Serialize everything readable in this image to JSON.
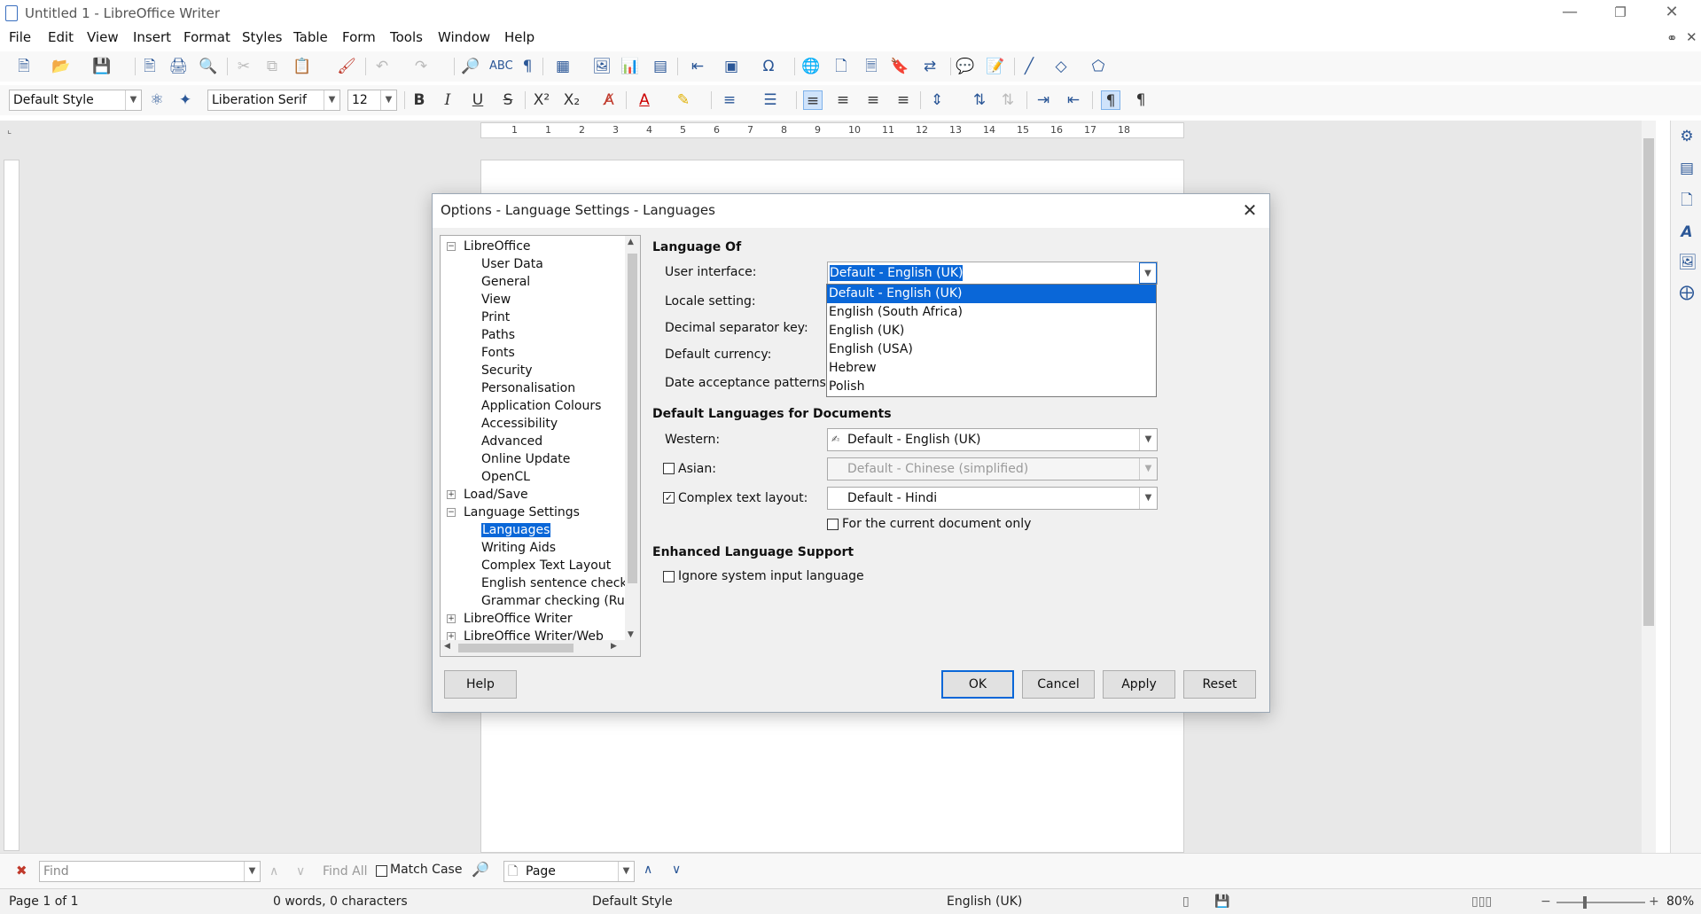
{
  "window": {
    "title": "Untitled 1 - LibreOffice Writer"
  },
  "menu": [
    "File",
    "Edit",
    "View",
    "Insert",
    "Format",
    "Styles",
    "Table",
    "Form",
    "Tools",
    "Window",
    "Help"
  ],
  "formatting": {
    "paragraph_style": "Default Style",
    "font_name": "Liberation Serif",
    "font_size": "12"
  },
  "ruler_ticks": [
    "1",
    "1",
    "2",
    "3",
    "4",
    "5",
    "6",
    "7",
    "8",
    "9",
    "10",
    "11",
    "12",
    "13",
    "14",
    "15",
    "16",
    "17",
    "18"
  ],
  "findbar": {
    "find_placeholder": "Find",
    "find_all": "Find All",
    "match_case": "Match Case",
    "nav_target": "Page"
  },
  "status": {
    "page": "Page 1 of 1",
    "words": "0 words, 0 characters",
    "style": "Default Style",
    "language": "English (UK)",
    "zoom": "80%"
  },
  "dialog": {
    "title": "Options - Language Settings - Languages",
    "tree": [
      {
        "label": "LibreOffice",
        "level": 0,
        "expander": "−"
      },
      {
        "label": "User Data",
        "level": 1
      },
      {
        "label": "General",
        "level": 1
      },
      {
        "label": "View",
        "level": 1
      },
      {
        "label": "Print",
        "level": 1
      },
      {
        "label": "Paths",
        "level": 1
      },
      {
        "label": "Fonts",
        "level": 1
      },
      {
        "label": "Security",
        "level": 1
      },
      {
        "label": "Personalisation",
        "level": 1
      },
      {
        "label": "Application Colours",
        "level": 1
      },
      {
        "label": "Accessibility",
        "level": 1
      },
      {
        "label": "Advanced",
        "level": 1
      },
      {
        "label": "Online Update",
        "level": 1
      },
      {
        "label": "OpenCL",
        "level": 1
      },
      {
        "label": "Load/Save",
        "level": 0,
        "expander": "+"
      },
      {
        "label": "Language Settings",
        "level": 0,
        "expander": "−"
      },
      {
        "label": "Languages",
        "level": 1,
        "selected": true
      },
      {
        "label": "Writing Aids",
        "level": 1
      },
      {
        "label": "Complex Text Layout",
        "level": 1
      },
      {
        "label": "English sentence checkir",
        "level": 1
      },
      {
        "label": "Grammar checking (Rus:",
        "level": 1
      },
      {
        "label": "LibreOffice Writer",
        "level": 0,
        "expander": "+"
      },
      {
        "label": "LibreOffice Writer/Web",
        "level": 0,
        "expander": "+"
      }
    ],
    "language_of": {
      "heading": "Language Of",
      "user_interface_label": "User interface:",
      "user_interface_value": "Default - English (UK)",
      "locale_label": "Locale setting:",
      "decimal_label": "Decimal separator key:",
      "currency_label": "Default currency:",
      "date_label": "Date acceptance patterns:"
    },
    "ui_options": [
      {
        "label": "Default - English (UK)",
        "selected": true
      },
      {
        "label": "English (South Africa)"
      },
      {
        "label": "English (UK)"
      },
      {
        "label": "English (USA)"
      },
      {
        "label": "Hebrew"
      },
      {
        "label": "Polish"
      }
    ],
    "default_languages": {
      "heading": "Default Languages for Documents",
      "western_label": "Western:",
      "western_value": "Default - English (UK)",
      "asian_label": "Asian:",
      "asian_checked": false,
      "asian_value": "Default - Chinese (simplified)",
      "ctl_label": "Complex text layout:",
      "ctl_checked": true,
      "ctl_value": "Default - Hindi",
      "current_doc_label": "For the current document only",
      "current_doc_checked": false
    },
    "enhanced": {
      "heading": "Enhanced Language Support",
      "ignore_label": "Ignore system input language",
      "ignore_checked": false
    },
    "buttons": {
      "help": "Help",
      "ok": "OK",
      "cancel": "Cancel",
      "apply": "Apply",
      "reset": "Reset"
    }
  }
}
